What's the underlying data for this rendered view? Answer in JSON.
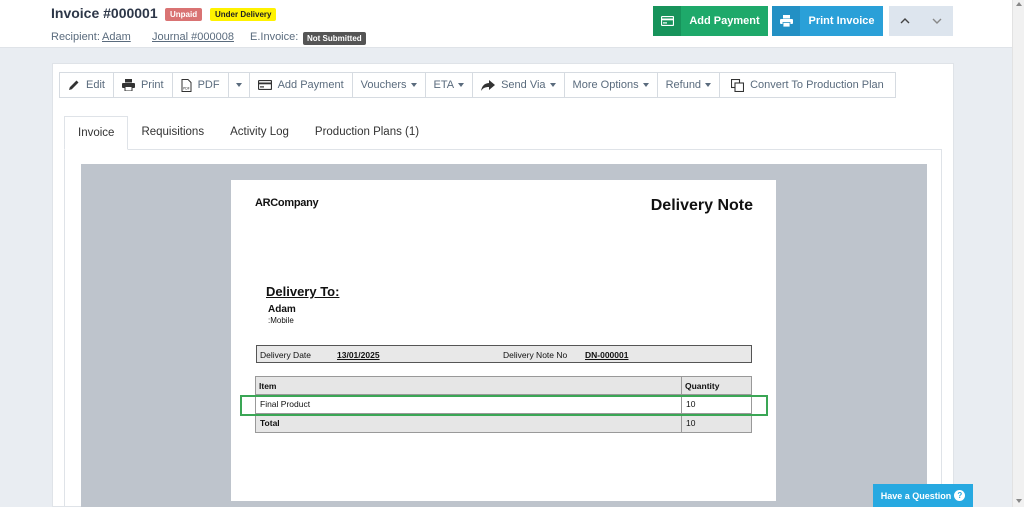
{
  "header": {
    "title": "Invoice #000001",
    "badges": {
      "unpaid": "Unpaid",
      "status": "Under Delivery",
      "einvoice": "Not Submitted"
    },
    "recipient_label": "Recipient:",
    "recipient_name": "Adam",
    "journal": "Journal #000008",
    "einvoice_label": "E.Invoice:",
    "add_payment": "Add Payment",
    "print_invoice": "Print Invoice",
    "colors": {
      "green": "#1ea96a",
      "blue": "#2aa0d8"
    }
  },
  "toolbar": {
    "edit": "Edit",
    "print": "Print",
    "pdf": "PDF",
    "add_payment": "Add Payment",
    "vouchers": "Vouchers",
    "eta": "ETA",
    "send_via": "Send Via",
    "more_options": "More Options",
    "refund": "Refund",
    "convert": "Convert To Production Plan"
  },
  "tabs": [
    "Invoice",
    "Requisitions",
    "Activity Log",
    "Production Plans (1)"
  ],
  "document": {
    "company": "ARCompany",
    "title": "Delivery Note",
    "delivery_to": "Delivery To:",
    "customer_name": "Adam",
    "customer_mobile": ":Mobile",
    "delivery_date_label": "Delivery Date",
    "delivery_date": "13/01/2025",
    "note_no_label": "Delivery Note No",
    "note_no": "DN-000001",
    "table": {
      "headers": [
        "Item",
        "Quantity"
      ],
      "rows": [
        {
          "item": "Final Product",
          "quantity": "10"
        }
      ],
      "total_label": "Total",
      "total_quantity": "10"
    }
  },
  "help": {
    "label": "Have a Question"
  }
}
